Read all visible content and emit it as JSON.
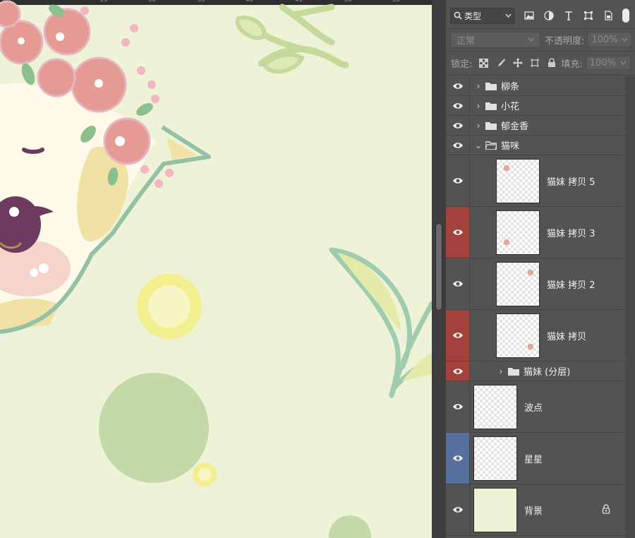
{
  "ruler": {
    "labels": [
      "20",
      "25",
      "30",
      "35",
      "40",
      "45",
      "50",
      "55",
      "60",
      "65"
    ]
  },
  "filter": {
    "kind_label": "类型",
    "icons": [
      "image-filter-icon",
      "adjustment-filter-icon",
      "type-filter-icon",
      "shape-filter-icon",
      "smart-object-filter-icon"
    ]
  },
  "blend": {
    "mode": "正常",
    "opacity_label": "不透明度:",
    "opacity_value": "100%",
    "lock_label": "锁定:",
    "fill_label": "填充:",
    "fill_value": "100%"
  },
  "layers": [
    {
      "name": "柳条",
      "type": "group",
      "expanded": false,
      "indent": 0,
      "highlight": "none"
    },
    {
      "name": "小花",
      "type": "group",
      "expanded": false,
      "indent": 0,
      "highlight": "none"
    },
    {
      "name": "郁金香",
      "type": "group",
      "expanded": false,
      "indent": 0,
      "highlight": "none"
    },
    {
      "name": "猫咪",
      "type": "group",
      "expanded": true,
      "indent": 0,
      "highlight": "none"
    },
    {
      "name": "猫妹 拷贝 5",
      "type": "image",
      "indent": 1,
      "highlight": "none"
    },
    {
      "name": "猫妹 拷贝 3",
      "type": "image",
      "indent": 1,
      "highlight": "red"
    },
    {
      "name": "猫妹 拷贝 2",
      "type": "image",
      "indent": 1,
      "highlight": "none"
    },
    {
      "name": "猫妹 拷贝",
      "type": "image",
      "indent": 1,
      "highlight": "red"
    },
    {
      "name": "猫妹 (分层)",
      "type": "group",
      "expanded": false,
      "indent": 1,
      "highlight": "red"
    },
    {
      "name": "波点",
      "type": "image",
      "indent": 0,
      "highlight": "none"
    },
    {
      "name": "星星",
      "type": "image",
      "indent": 0,
      "highlight": "blue"
    },
    {
      "name": "背景",
      "type": "background",
      "indent": 0,
      "highlight": "none",
      "locked": true
    }
  ],
  "colors": {
    "canvas_bg": "#eef3d7",
    "highlight_red": "#a2413e",
    "highlight_blue": "#58709d",
    "panel_bg": "#535353"
  }
}
